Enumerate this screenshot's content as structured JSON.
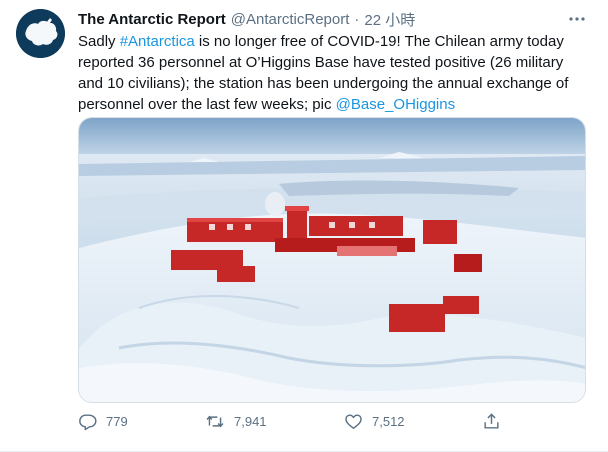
{
  "tweet": {
    "author": {
      "display_name": "The Antarctic Report",
      "handle": "@AntarcticReport",
      "avatar_icon": "antarctica-map-avatar",
      "avatar_bg": "#0e3a5c"
    },
    "separator": "·",
    "timestamp": "22 小時",
    "more_icon": "more-horizontal-icon",
    "text": {
      "part1": "Sadly ",
      "hashtag": "#Antarctica",
      "part2": " is no longer free of COVID-19! The Chilean army today reported 36 personnel at O’Higgins Base have tested positive (26 military and 10 civilians); the station has been undergoing the annual exchange of personnel over the last few weeks; pic ",
      "mention": "@Base_OHiggins"
    },
    "media": {
      "description_icon": "photo-image"
    },
    "actions": {
      "reply": {
        "icon": "reply-icon",
        "count": "779"
      },
      "retweet": {
        "icon": "retweet-icon",
        "count": "7,941"
      },
      "like": {
        "icon": "heart-icon",
        "count": "7,512"
      },
      "share": {
        "icon": "share-icon"
      }
    }
  },
  "colors": {
    "link": "#1b95e0",
    "secondary_text": "#5b7083",
    "primary_text": "#0f1419"
  }
}
